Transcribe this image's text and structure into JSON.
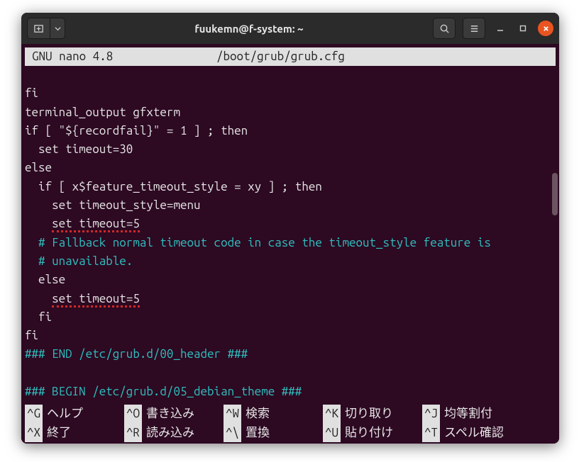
{
  "titlebar": {
    "title": "fuukemn@f-system: ~"
  },
  "nano": {
    "app": "GNU nano 4.8",
    "path": "/boot/grub/grub.cfg"
  },
  "code": {
    "l1": "fi",
    "l2": "terminal_output gfxterm",
    "l3": "if [ \"${recordfail}\" = 1 ] ; then",
    "l4": "  set timeout=30",
    "l5": "else",
    "l6": "  if [ x$feature_timeout_style = xy ] ; then",
    "l7": "    set timeout_style=menu",
    "l8_pre": "    ",
    "l8_u": "set timeout=5",
    "l9": "  # Fallback normal timeout code in case the timeout_style feature is",
    "l10": "  # unavailable.",
    "l11": "  else",
    "l12_pre": "    ",
    "l12_u": "set timeout=5",
    "l13": "  fi",
    "l14": "fi",
    "l15": "### END /etc/grub.d/00_header ###",
    "l16": "",
    "l17": "### BEGIN /etc/grub.d/05_debian_theme ###"
  },
  "shortcuts": {
    "row1": [
      {
        "key": "^G",
        "label": "ヘルプ"
      },
      {
        "key": "^O",
        "label": "書き込み"
      },
      {
        "key": "^W",
        "label": "検索"
      },
      {
        "key": "^K",
        "label": "切り取り"
      },
      {
        "key": "^J",
        "label": "均等割付"
      }
    ],
    "row2": [
      {
        "key": "^X",
        "label": "終了"
      },
      {
        "key": "^R",
        "label": "読み込み"
      },
      {
        "key": "^\\",
        "label": "置換"
      },
      {
        "key": "^U",
        "label": "貼り付け"
      },
      {
        "key": "^T",
        "label": "スペル確認"
      }
    ]
  }
}
